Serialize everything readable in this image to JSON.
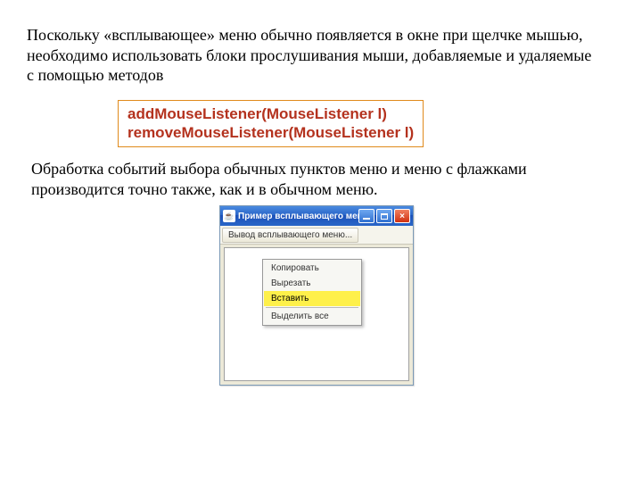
{
  "para1": "Поскольку «всплывающее» меню обычно появляется в окне при щелчке мышью, необходимо использовать блоки прослушивания мыши, добавляемые и удаляемые с помощью методов",
  "code": {
    "line1": "addMouseListener(MouseListener l)",
    "line2": "removeMouseListener(MouseListener l)"
  },
  "para2": "Обработка событий выбора обычных пунктов меню и меню с флажками производится точно также, как и в обычном меню.",
  "window": {
    "java_icon": "☕",
    "title": "Пример всплывающего меню",
    "close_glyph": "×",
    "menubar_item": "Вывод всплывающего меню...",
    "popup": {
      "item1": "Копировать",
      "item2": "Вырезать",
      "item3": "Вставить",
      "item4": "Выделить все"
    }
  }
}
